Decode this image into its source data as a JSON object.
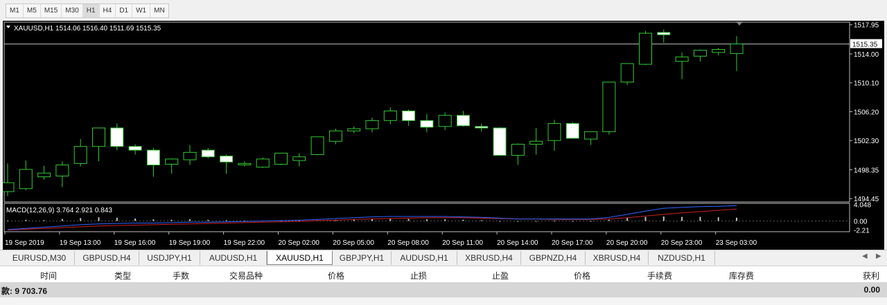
{
  "timeframes": [
    {
      "label": "M1",
      "active": false
    },
    {
      "label": "M5",
      "active": false
    },
    {
      "label": "M15",
      "active": false
    },
    {
      "label": "M30",
      "active": false
    },
    {
      "label": "H1",
      "active": true
    },
    {
      "label": "H4",
      "active": false
    },
    {
      "label": "D1",
      "active": false
    },
    {
      "label": "W1",
      "active": false
    },
    {
      "label": "MN",
      "active": false
    }
  ],
  "chart": {
    "header": "XAUUSD,H1  1514.06 1516.40 1511.69 1515.35",
    "current_price": "1515.35",
    "price_ticks": [
      "1517.95",
      "1514.00",
      "1510.10",
      "1506.20",
      "1502.30",
      "1498.35",
      "1494.45"
    ],
    "macd_label": "MACD(12,26,9) 3.764 2.921 0.843",
    "macd_ticks": [
      "4.048",
      "0.00",
      "-2.21"
    ],
    "time_ticks": [
      "19 Sep 2019",
      "19 Sep 13:00",
      "19 Sep 16:00",
      "19 Sep 19:00",
      "19 Sep 22:00",
      "20 Sep 02:00",
      "20 Sep 05:00",
      "20 Sep 08:00",
      "20 Sep 11:00",
      "20 Sep 14:00",
      "20 Sep 17:00",
      "20 Sep 20:00",
      "20 Sep 23:00",
      "23 Sep 03:00"
    ],
    "colors": {
      "background": "#000000",
      "bull_fill": "#ffffff",
      "bear_fill": "#ffffff",
      "wick": "#33cc33",
      "macd_line": "#3366ff",
      "signal_line": "#cc2222",
      "price_line": "#c0c0c0"
    }
  },
  "chart_data": {
    "type": "candlestick",
    "symbol": "XAUUSD",
    "timeframe": "H1",
    "ylim": [
      1494.0,
      1518.3
    ],
    "candles": [
      {
        "o": 1495.4,
        "h": 1499.2,
        "l": 1494.8,
        "c": 1496.6
      },
      {
        "o": 1495.8,
        "h": 1499.6,
        "l": 1495.6,
        "c": 1498.4
      },
      {
        "o": 1497.4,
        "h": 1498.9,
        "l": 1497.0,
        "c": 1497.9
      },
      {
        "o": 1497.5,
        "h": 1499.5,
        "l": 1496.0,
        "c": 1499.0
      },
      {
        "o": 1499.2,
        "h": 1502.5,
        "l": 1498.8,
        "c": 1501.5
      },
      {
        "o": 1501.5,
        "h": 1504.0,
        "l": 1499.5,
        "c": 1504.0
      },
      {
        "o": 1504.0,
        "h": 1504.6,
        "l": 1501.0,
        "c": 1501.5
      },
      {
        "o": 1501.5,
        "h": 1501.8,
        "l": 1500.4,
        "c": 1501.0
      },
      {
        "o": 1501.0,
        "h": 1501.3,
        "l": 1497.4,
        "c": 1499.0
      },
      {
        "o": 1499.1,
        "h": 1499.9,
        "l": 1497.8,
        "c": 1499.8
      },
      {
        "o": 1499.7,
        "h": 1501.7,
        "l": 1499.0,
        "c": 1500.7
      },
      {
        "o": 1501.0,
        "h": 1501.3,
        "l": 1499.9,
        "c": 1500.1
      },
      {
        "o": 1500.2,
        "h": 1500.4,
        "l": 1497.8,
        "c": 1499.4
      },
      {
        "o": 1499.1,
        "h": 1499.5,
        "l": 1498.8,
        "c": 1499.2
      },
      {
        "o": 1498.7,
        "h": 1500.0,
        "l": 1498.6,
        "c": 1499.8
      },
      {
        "o": 1499.1,
        "h": 1500.6,
        "l": 1499.0,
        "c": 1500.6
      },
      {
        "o": 1499.6,
        "h": 1500.6,
        "l": 1498.8,
        "c": 1500.1
      },
      {
        "o": 1500.4,
        "h": 1502.8,
        "l": 1500.3,
        "c": 1502.8
      },
      {
        "o": 1502.2,
        "h": 1503.9,
        "l": 1501.8,
        "c": 1503.6
      },
      {
        "o": 1503.6,
        "h": 1504.2,
        "l": 1503.3,
        "c": 1503.9
      },
      {
        "o": 1503.9,
        "h": 1505.4,
        "l": 1503.4,
        "c": 1505.0
      },
      {
        "o": 1505.0,
        "h": 1506.8,
        "l": 1504.5,
        "c": 1506.3
      },
      {
        "o": 1506.3,
        "h": 1506.5,
        "l": 1504.3,
        "c": 1505.0
      },
      {
        "o": 1505.0,
        "h": 1505.9,
        "l": 1503.4,
        "c": 1504.1
      },
      {
        "o": 1504.2,
        "h": 1506.1,
        "l": 1503.7,
        "c": 1505.7
      },
      {
        "o": 1505.7,
        "h": 1506.3,
        "l": 1504.2,
        "c": 1504.3
      },
      {
        "o": 1504.2,
        "h": 1504.6,
        "l": 1503.5,
        "c": 1504.0
      },
      {
        "o": 1504.0,
        "h": 1504.1,
        "l": 1500.3,
        "c": 1500.3
      },
      {
        "o": 1500.3,
        "h": 1501.9,
        "l": 1499.0,
        "c": 1501.8
      },
      {
        "o": 1501.8,
        "h": 1504.0,
        "l": 1500.4,
        "c": 1502.2
      },
      {
        "o": 1502.3,
        "h": 1505.1,
        "l": 1500.9,
        "c": 1504.6
      },
      {
        "o": 1504.6,
        "h": 1504.8,
        "l": 1502.6,
        "c": 1502.6
      },
      {
        "o": 1502.5,
        "h": 1503.5,
        "l": 1501.7,
        "c": 1503.5
      },
      {
        "o": 1503.5,
        "h": 1510.2,
        "l": 1503.1,
        "c": 1510.2
      },
      {
        "o": 1510.2,
        "h": 1512.7,
        "l": 1509.8,
        "c": 1512.7
      },
      {
        "o": 1512.6,
        "h": 1517.1,
        "l": 1512.5,
        "c": 1516.8
      },
      {
        "o": 1516.9,
        "h": 1517.3,
        "l": 1515.5,
        "c": 1516.6
      },
      {
        "o": 1513.0,
        "h": 1514.2,
        "l": 1510.6,
        "c": 1513.6
      },
      {
        "o": 1513.7,
        "h": 1514.6,
        "l": 1513.0,
        "c": 1514.5
      },
      {
        "o": 1514.2,
        "h": 1514.8,
        "l": 1513.8,
        "c": 1514.6
      },
      {
        "o": 1514.06,
        "h": 1516.4,
        "l": 1511.69,
        "c": 1515.35
      }
    ],
    "macd": {
      "ylim": [
        -2.6,
        4.3
      ],
      "histogram": [
        0.1,
        0.3,
        0.2,
        0.5,
        0.7,
        0.9,
        0.8,
        0.6,
        0.4,
        0.3,
        0.4,
        0.3,
        0.2,
        0.1,
        0.1,
        0.1,
        0.1,
        0.2,
        0.3,
        0.4,
        0.5,
        0.6,
        0.5,
        0.4,
        0.4,
        0.3,
        0.2,
        0.0,
        -0.1,
        0.0,
        0.1,
        0.0,
        0.0,
        0.3,
        0.8,
        1.0,
        1.1,
        1.0,
        1.0,
        0.9,
        0.8
      ],
      "macd_line": [
        -2.1,
        -1.8,
        -1.5,
        -1.2,
        -0.9,
        -0.7,
        -0.6,
        -0.5,
        -0.5,
        -0.4,
        -0.3,
        -0.3,
        -0.2,
        -0.1,
        0.0,
        0.1,
        0.2,
        0.4,
        0.6,
        0.8,
        1.0,
        1.1,
        1.1,
        1.1,
        1.1,
        1.0,
        0.9,
        0.7,
        0.5,
        0.5,
        0.5,
        0.5,
        0.5,
        0.9,
        1.6,
        2.4,
        3.1,
        3.3,
        3.5,
        3.6,
        3.764
      ],
      "signal_line": [
        -2.2,
        -2.0,
        -1.8,
        -1.6,
        -1.4,
        -1.2,
        -1.1,
        -1.0,
        -0.9,
        -0.8,
        -0.7,
        -0.6,
        -0.5,
        -0.4,
        -0.3,
        -0.2,
        -0.1,
        0.1,
        0.2,
        0.4,
        0.5,
        0.6,
        0.7,
        0.8,
        0.8,
        0.8,
        0.7,
        0.6,
        0.5,
        0.5,
        0.4,
        0.4,
        0.4,
        0.5,
        0.8,
        1.2,
        1.6,
        2.0,
        2.3,
        2.6,
        2.921
      ]
    }
  },
  "symbol_tabs": [
    {
      "label": "EURUSD,M30",
      "active": false
    },
    {
      "label": "GBPUSD,H4",
      "active": false
    },
    {
      "label": "USDJPY,H1",
      "active": false
    },
    {
      "label": "AUDUSD,H1",
      "active": false
    },
    {
      "label": "XAUUSD,H1",
      "active": true
    },
    {
      "label": "GBPJPY,H1",
      "active": false
    },
    {
      "label": "AUDUSD,H1",
      "active": false
    },
    {
      "label": "XBRUSD,H4",
      "active": false
    },
    {
      "label": "GBPNZD,H4",
      "active": false
    },
    {
      "label": "XBRUSD,H4",
      "active": false
    },
    {
      "label": "NZDUSD,H1",
      "active": false
    }
  ],
  "scroll": {
    "left": "◀",
    "right": "▶"
  },
  "terminal": {
    "columns": [
      "时间",
      "类型",
      "手数",
      "交易品种",
      "价格",
      "止损",
      "止盈",
      "价格",
      "手续费",
      "库存费",
      "获利"
    ],
    "balance_label": "款: 9 703.76",
    "profit": "0.00"
  }
}
